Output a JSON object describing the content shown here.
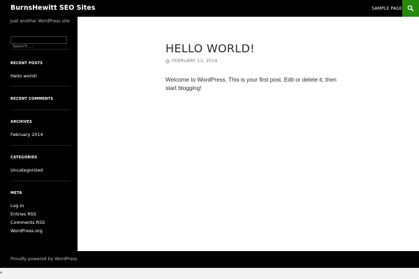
{
  "header": {
    "site_title": "BurnsHewitt SEO Sites",
    "nav": [
      {
        "label": "Sample Page"
      }
    ],
    "search_icon": "search-icon",
    "accent": "#24890d"
  },
  "sidebar": {
    "description": "Just another WordPress site",
    "search": {
      "placeholder": "Search …"
    },
    "recent_posts": {
      "title": "Recent Posts",
      "items": [
        {
          "label": "Hello world!"
        }
      ]
    },
    "recent_comments": {
      "title": "Recent Comments"
    },
    "archives": {
      "title": "Archives",
      "items": [
        {
          "label": "February 2014"
        }
      ]
    },
    "categories": {
      "title": "Categories",
      "items": [
        {
          "label": "Uncategorized"
        }
      ]
    },
    "meta": {
      "title": "Meta",
      "items": [
        {
          "label": "Log in"
        },
        {
          "label": "Entries RSS"
        },
        {
          "label": "Comments RSS"
        },
        {
          "label": "WordPress.org"
        }
      ]
    }
  },
  "post": {
    "title": "Hello world!",
    "date": "February 13, 2014",
    "date_icon": "clock-icon",
    "content": "Welcome to WordPress. This is your first post. Edit or delete it, then start blogging!"
  },
  "footer": {
    "credit": "Proudly powered by WordPress"
  }
}
